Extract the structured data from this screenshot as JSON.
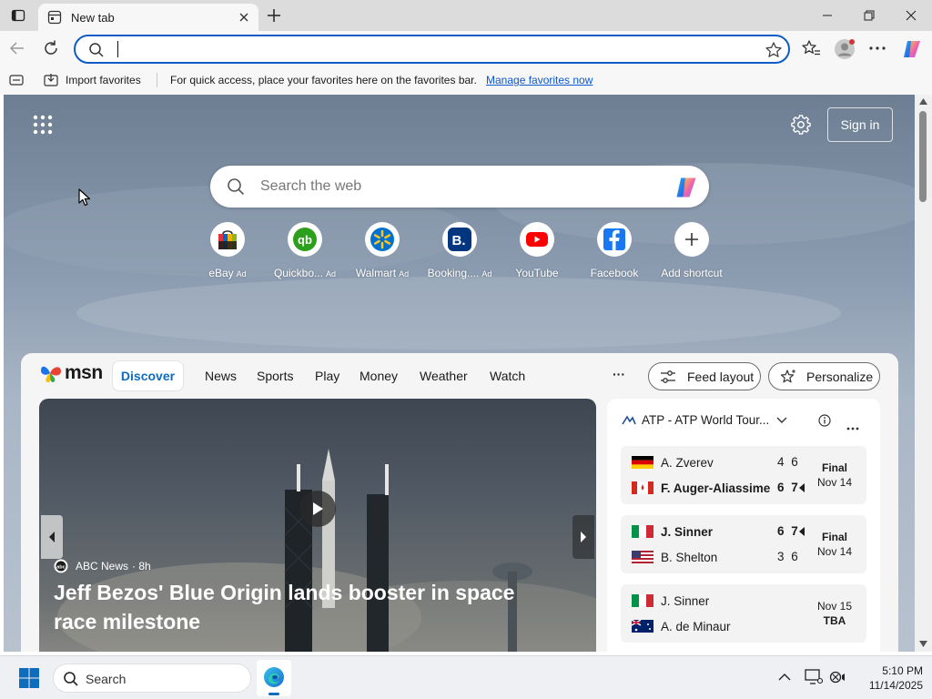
{
  "browser": {
    "tab_title": "New tab",
    "address_value": "",
    "favbar": {
      "import_label": "Import favorites",
      "hint": "For quick access, place your favorites here on the favorites bar.",
      "manage_link": "Manage favorites now"
    }
  },
  "ntp": {
    "sign_in": "Sign in",
    "search_placeholder": "Search the web",
    "shortcuts": [
      {
        "label": "eBay",
        "ad": "Ad",
        "icon": "ebay-icon"
      },
      {
        "label": "Quickbo...",
        "ad": "Ad",
        "icon": "quickbooks-icon"
      },
      {
        "label": "Walmart",
        "ad": "Ad",
        "icon": "walmart-icon"
      },
      {
        "label": "Booking....",
        "ad": "Ad",
        "icon": "booking-icon"
      },
      {
        "label": "YouTube",
        "ad": "",
        "icon": "youtube-icon"
      },
      {
        "label": "Facebook",
        "ad": "",
        "icon": "facebook-icon"
      },
      {
        "label": "Add shortcut",
        "ad": "",
        "icon": "plus-icon"
      }
    ]
  },
  "feed": {
    "logo": "msn",
    "nav": [
      "Discover",
      "News",
      "Sports",
      "Play",
      "Money",
      "Weather",
      "Watch"
    ],
    "more": "···",
    "feed_layout": "Feed layout",
    "personalize": "Personalize",
    "hero": {
      "source": "ABC News",
      "age": "· 8h",
      "headline": "Jeff Bezos' Blue Origin lands booster in space race milestone"
    },
    "sports": {
      "league": "ATP - ATP World Tour...",
      "matches": [
        {
          "p1": {
            "name": "A. Zverev",
            "score": "4 6",
            "flag": "germany",
            "bold": false
          },
          "p2": {
            "name": "F. Auger-Aliassime",
            "score": "6 7",
            "flag": "canada",
            "bold": true
          },
          "status": "Final",
          "date": "Nov 14",
          "winner": 2
        },
        {
          "p1": {
            "name": "J. Sinner",
            "score": "6 7",
            "flag": "italy",
            "bold": true
          },
          "p2": {
            "name": "B. Shelton",
            "score": "3 6",
            "flag": "usa",
            "bold": false
          },
          "status": "Final",
          "date": "Nov 14",
          "winner": 1
        },
        {
          "p1": {
            "name": "J. Sinner",
            "score": "",
            "flag": "italy",
            "bold": false
          },
          "p2": {
            "name": "A. de Minaur",
            "score": "",
            "flag": "australia",
            "bold": false
          },
          "status": "TBA",
          "date": "Nov 15",
          "winner": 0
        }
      ]
    }
  },
  "taskbar": {
    "search_placeholder": "Search",
    "time": "5:10 PM",
    "date": "11/14/2025"
  },
  "colors": {
    "accent": "#0f5bc6",
    "link": "#0b57d0",
    "active_tab": "#0f6cbd"
  }
}
